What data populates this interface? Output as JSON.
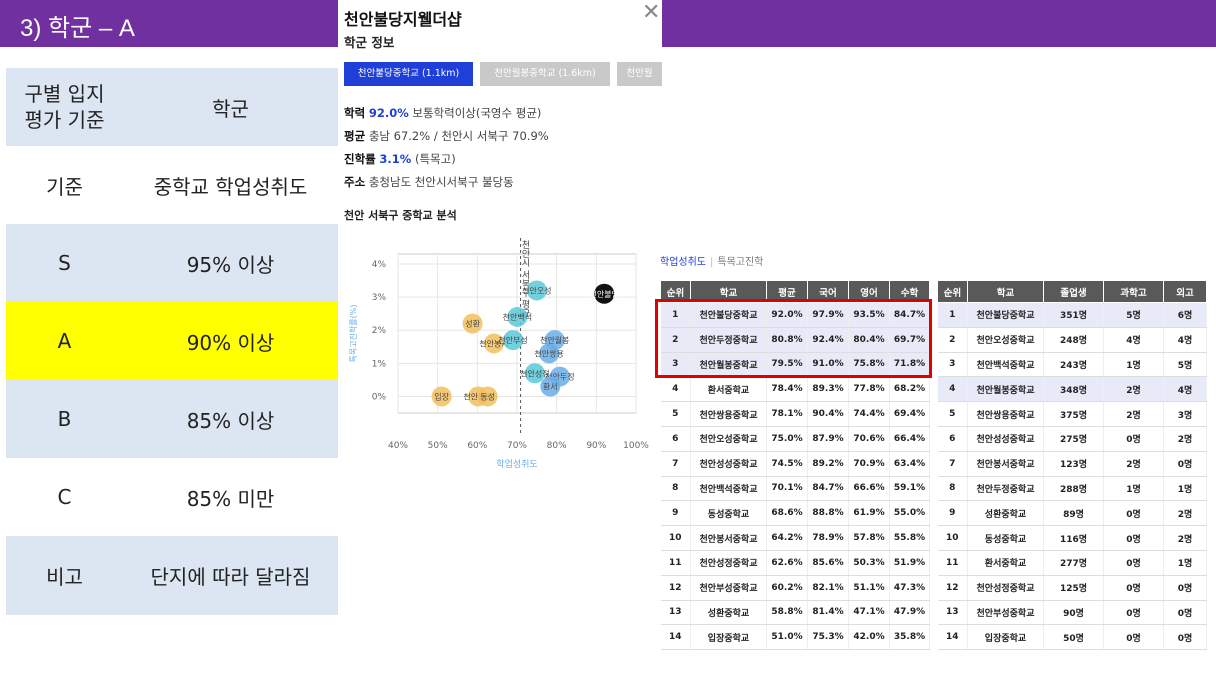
{
  "slide": {
    "title": "3) 학군 – A"
  },
  "grade_table": {
    "header": {
      "label": "구별 입지\n평가 기준",
      "value": "학군"
    },
    "rows": [
      {
        "label": "기준",
        "value": "중학교 학업성취도"
      },
      {
        "label": "S",
        "value": "95% 이상"
      },
      {
        "label": "A",
        "value": "90% 이상"
      },
      {
        "label": "B",
        "value": "85% 이상"
      },
      {
        "label": "C",
        "value": "85% 미만"
      },
      {
        "label": "비고",
        "value": "단지에 따라 달라짐"
      }
    ]
  },
  "popup": {
    "title": "천안불당지웰더샵",
    "close": "✕",
    "subtitle": "학군 정보",
    "school_tabs": [
      "천안불당중학교 (1.1km)",
      "천안월봉중학교 (1.6km)",
      "천안월"
    ],
    "info": {
      "achievement_label": "학력",
      "achievement_value": "92.0%",
      "achievement_desc": "보통학력이상(국영수 평균)",
      "average_label": "평균",
      "average_desc": "충남 67.2% / 천안시 서북구 70.9%",
      "advance_label": "진학률",
      "advance_value": "3.1%",
      "advance_desc": "(특목고)",
      "address_label": "주소",
      "address_desc": "충청남도 천안시서북구 불당동"
    },
    "chart_title": "천안 서북구 중학교 분석"
  },
  "chart_data": {
    "type": "scatter",
    "xlabel": "학업성취도",
    "ylabel": "특목고진학률(%)",
    "xlim": [
      40,
      100
    ],
    "ylim": [
      -0.5,
      4.3
    ],
    "x_ticks": [
      "40%",
      "50%",
      "60%",
      "70%",
      "80%",
      "90%",
      "100%"
    ],
    "y_ticks": [
      "0%",
      "1%",
      "2%",
      "3%",
      "4%"
    ],
    "ref_line": {
      "x": 70.9,
      "label": "천안시 서북구 평균"
    },
    "colors": {
      "highlight": "#111111",
      "teal": "#5ac8d8",
      "blue": "#6aaee8",
      "orange": "#f2bf5e"
    },
    "points": [
      {
        "name": "천안불당",
        "x": 92.0,
        "y": 3.1,
        "color": "highlight"
      },
      {
        "name": "천안오성",
        "x": 75.0,
        "y": 3.2,
        "color": "teal"
      },
      {
        "name": "천안백석",
        "x": 70.1,
        "y": 2.4,
        "color": "teal"
      },
      {
        "name": "성환",
        "x": 58.8,
        "y": 2.2,
        "color": "orange"
      },
      {
        "name": "천안월봉",
        "x": 79.5,
        "y": 1.7,
        "color": "blue"
      },
      {
        "name": "천안봉서",
        "x": 64.2,
        "y": 1.6,
        "color": "orange"
      },
      {
        "name": "천안부성",
        "x": 69.0,
        "y": 1.7,
        "color": "teal"
      },
      {
        "name": "천안쌍용",
        "x": 78.1,
        "y": 1.3,
        "color": "blue"
      },
      {
        "name": "천안성정",
        "x": 74.5,
        "y": 0.7,
        "color": "teal"
      },
      {
        "name": "천안두정",
        "x": 80.8,
        "y": 0.6,
        "color": "blue"
      },
      {
        "name": "환서",
        "x": 78.4,
        "y": 0.3,
        "color": "blue"
      },
      {
        "name": "입장",
        "x": 51.0,
        "y": 0.0,
        "color": "orange"
      },
      {
        "name": "천안봉성",
        "x": 60.2,
        "y": 0.0,
        "color": "orange"
      },
      {
        "name": "동성",
        "x": 62.6,
        "y": 0.0,
        "color": "orange"
      }
    ]
  },
  "tabs": {
    "active": "학업성취도",
    "inactive": "특목고진학"
  },
  "achievement_table": {
    "headers": [
      "순위",
      "학교",
      "평균",
      "국어",
      "영어",
      "수학"
    ],
    "rows": [
      [
        "1",
        "천안불당중학교",
        "92.0%",
        "97.9%",
        "93.5%",
        "84.7%"
      ],
      [
        "2",
        "천안두정중학교",
        "80.8%",
        "92.4%",
        "80.4%",
        "69.7%"
      ],
      [
        "3",
        "천안월봉중학교",
        "79.5%",
        "91.0%",
        "75.8%",
        "71.8%"
      ],
      [
        "4",
        "환서중학교",
        "78.4%",
        "89.3%",
        "77.8%",
        "68.2%"
      ],
      [
        "5",
        "천안쌍용중학교",
        "78.1%",
        "90.4%",
        "74.4%",
        "69.4%"
      ],
      [
        "6",
        "천안오성중학교",
        "75.0%",
        "87.9%",
        "70.6%",
        "66.4%"
      ],
      [
        "7",
        "천안성성중학교",
        "74.5%",
        "89.2%",
        "70.9%",
        "63.4%"
      ],
      [
        "8",
        "천안백석중학교",
        "70.1%",
        "84.7%",
        "66.6%",
        "59.1%"
      ],
      [
        "9",
        "동성중학교",
        "68.6%",
        "88.8%",
        "61.9%",
        "55.0%"
      ],
      [
        "10",
        "천안봉서중학교",
        "64.2%",
        "78.9%",
        "57.8%",
        "55.8%"
      ],
      [
        "11",
        "천안성정중학교",
        "62.6%",
        "85.6%",
        "50.3%",
        "51.9%"
      ],
      [
        "12",
        "천안부성중학교",
        "60.2%",
        "82.1%",
        "51.1%",
        "47.3%"
      ],
      [
        "13",
        "성환중학교",
        "58.8%",
        "81.4%",
        "47.1%",
        "47.9%"
      ],
      [
        "14",
        "입장중학교",
        "51.0%",
        "75.3%",
        "42.0%",
        "35.8%"
      ]
    ]
  },
  "graduates_table": {
    "headers": [
      "순위",
      "학교",
      "졸업생",
      "과학고",
      "외고"
    ],
    "rows": [
      [
        "1",
        "천안불당중학교",
        "351명",
        "5명",
        "6명"
      ],
      [
        "2",
        "천안오성중학교",
        "248명",
        "4명",
        "4명"
      ],
      [
        "3",
        "천안백석중학교",
        "243명",
        "1명",
        "5명"
      ],
      [
        "4",
        "천안월봉중학교",
        "348명",
        "2명",
        "4명"
      ],
      [
        "5",
        "천안쌍용중학교",
        "375명",
        "2명",
        "3명"
      ],
      [
        "6",
        "천안성성중학교",
        "275명",
        "0명",
        "2명"
      ],
      [
        "7",
        "천안봉서중학교",
        "123명",
        "2명",
        "0명"
      ],
      [
        "8",
        "천안두정중학교",
        "288명",
        "1명",
        "1명"
      ],
      [
        "9",
        "성환중학교",
        "89명",
        "0명",
        "2명"
      ],
      [
        "10",
        "동성중학교",
        "116명",
        "0명",
        "2명"
      ],
      [
        "11",
        "환서중학교",
        "277명",
        "0명",
        "1명"
      ],
      [
        "12",
        "천안성정중학교",
        "125명",
        "0명",
        "0명"
      ],
      [
        "13",
        "천안부성중학교",
        "90명",
        "0명",
        "0명"
      ],
      [
        "14",
        "입장중학교",
        "50명",
        "0명",
        "0명"
      ]
    ]
  }
}
